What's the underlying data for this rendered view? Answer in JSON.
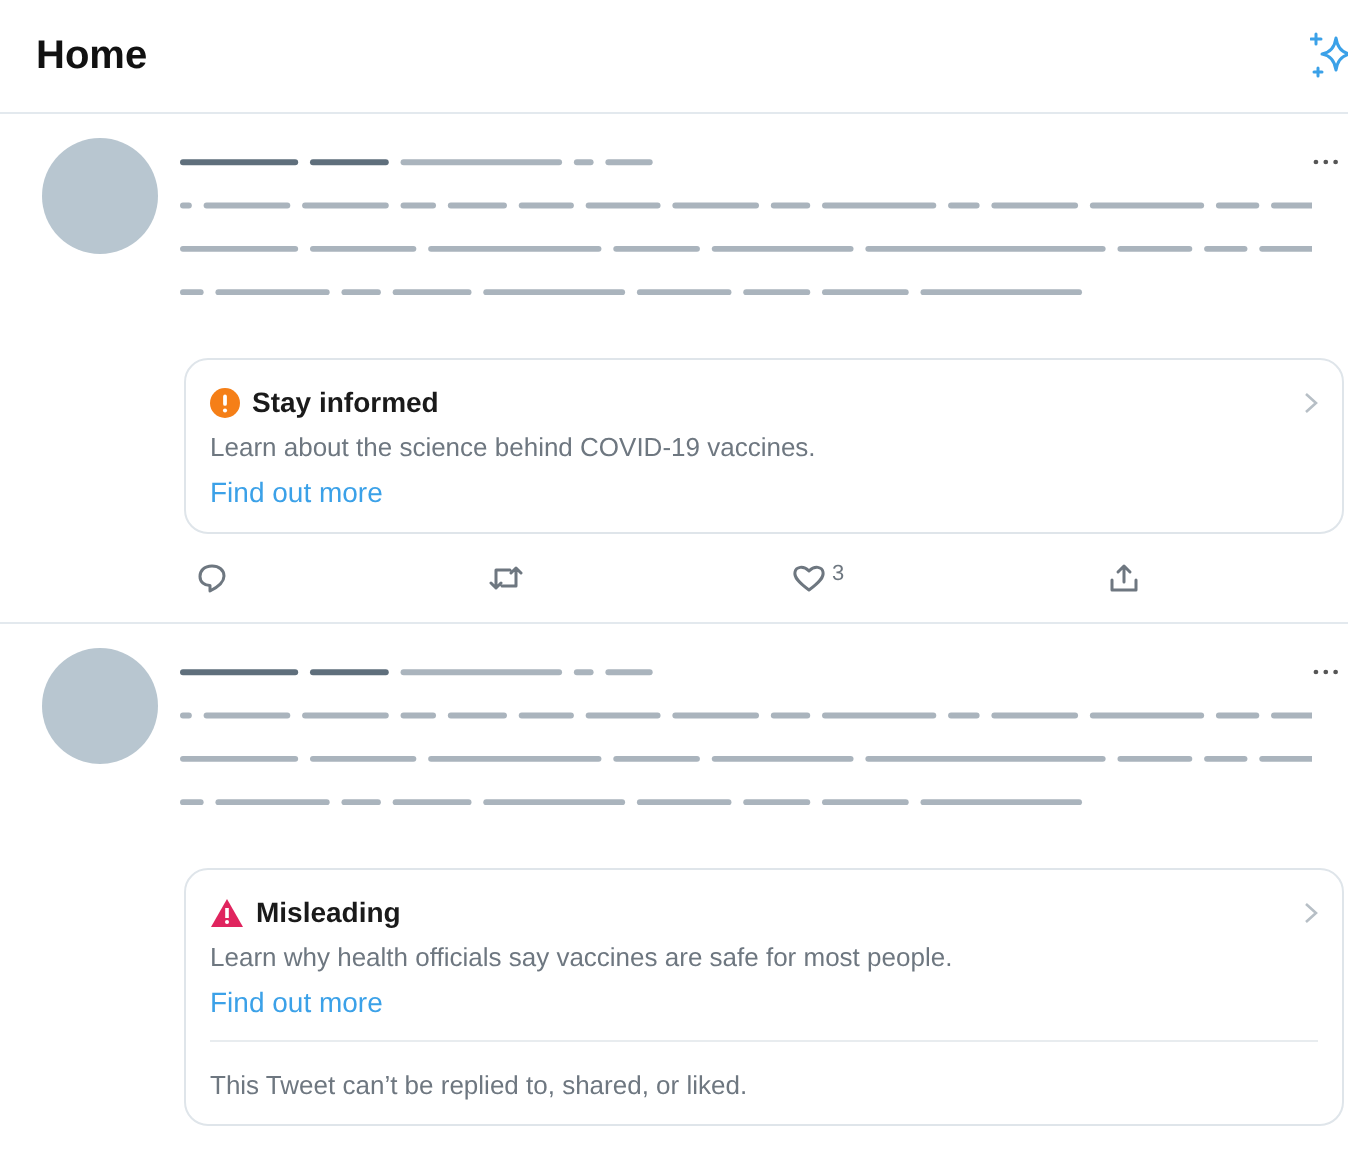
{
  "header": {
    "title": "Home"
  },
  "tweets": [
    {
      "notice": {
        "kind": "info",
        "title": "Stay informed",
        "body": "Learn about the science behind COVID-19 vaccines.",
        "link": "Find out more"
      },
      "actions": {
        "like_count": "3"
      }
    },
    {
      "notice": {
        "kind": "warning",
        "title": "Misleading",
        "body": "Learn why health officials say vaccines are safe for most people.",
        "link": "Find out more",
        "restriction": "This Tweet can’t be replied to, shared, or liked."
      }
    }
  ]
}
